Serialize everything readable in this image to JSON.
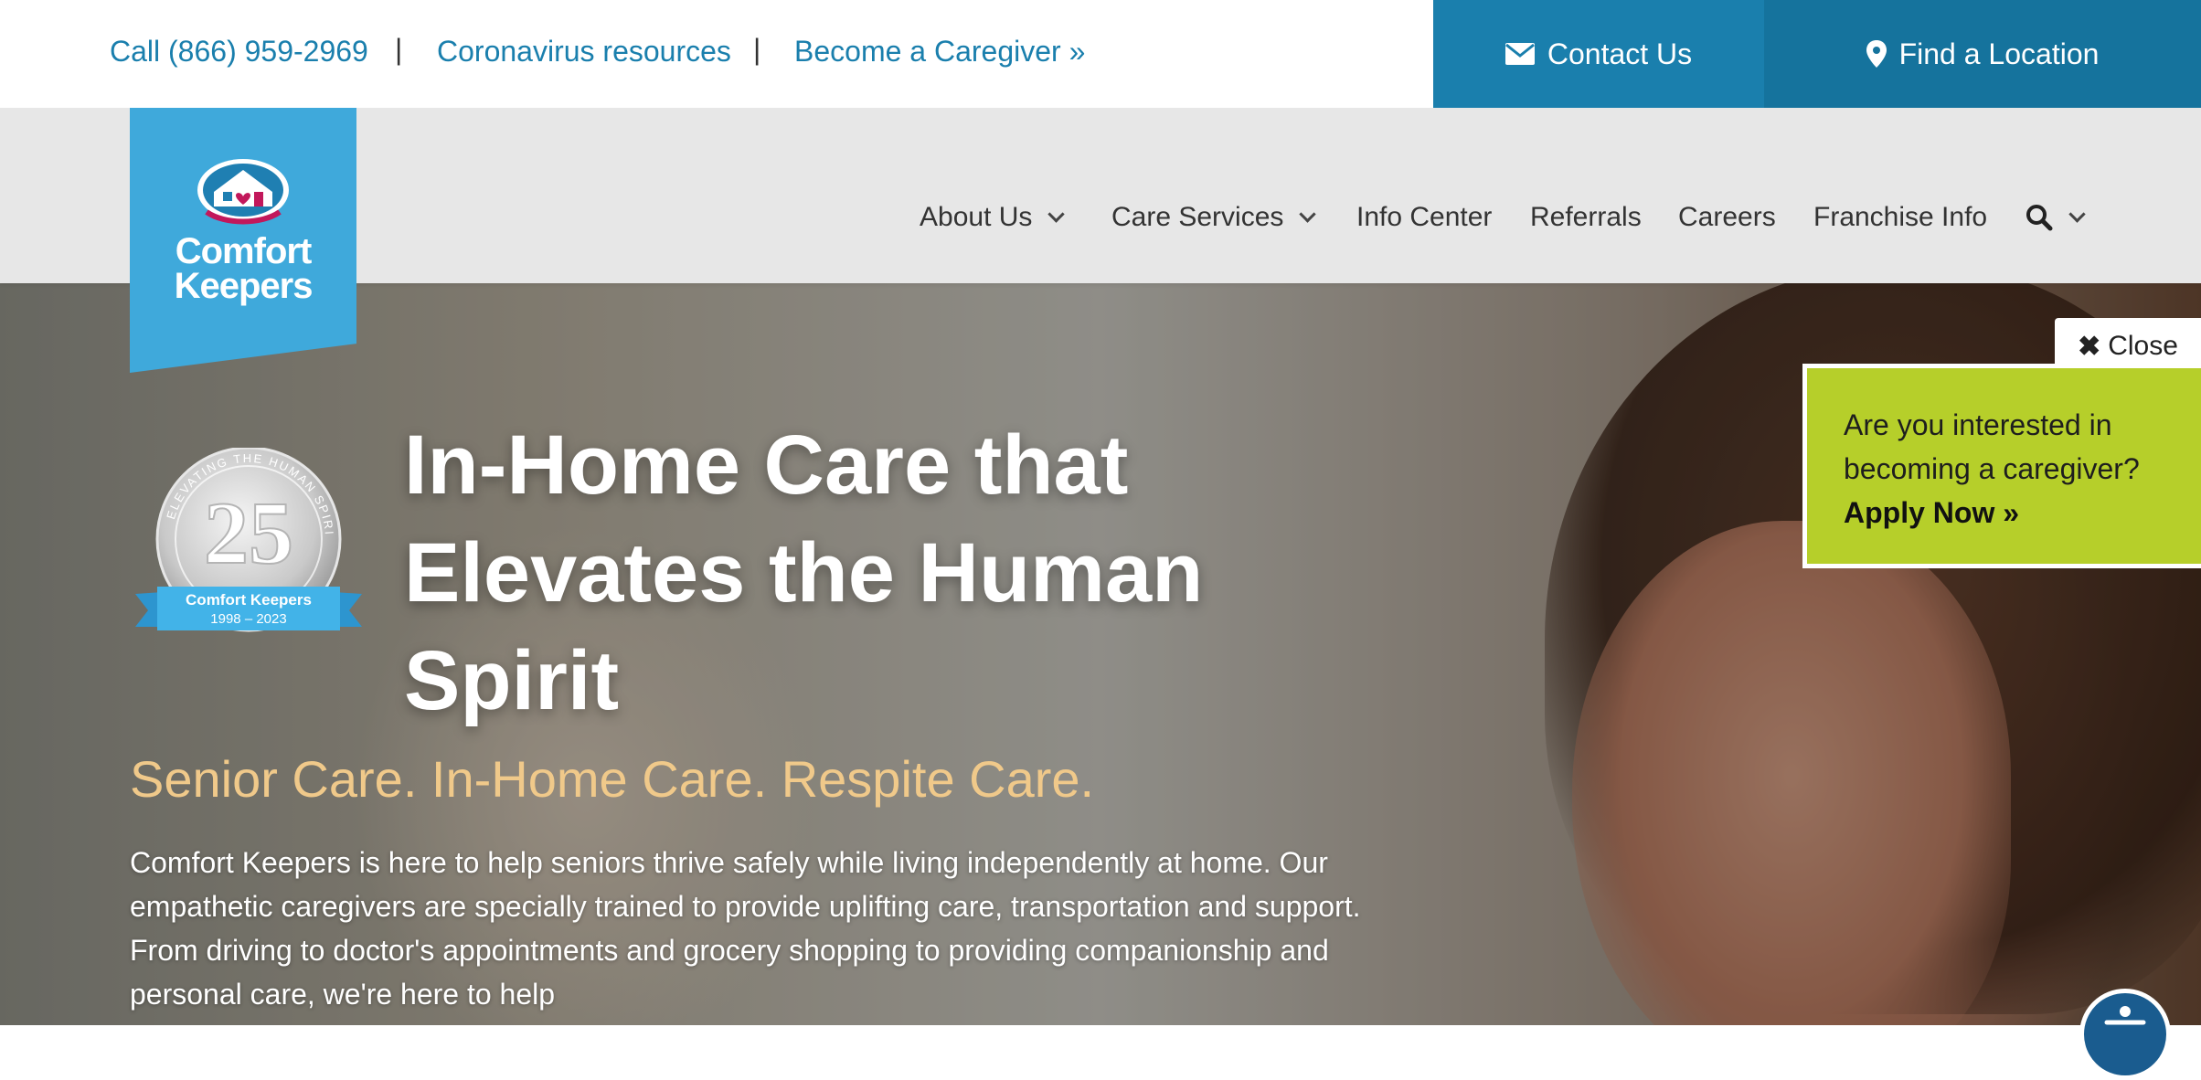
{
  "topbar": {
    "phone": "Call (866) 959-2969",
    "separator": "|",
    "covid": "Coronavirus resources",
    "caregiver": "Become a Caregiver »",
    "contact": "Contact Us",
    "find": "Find a Location"
  },
  "brand": {
    "line1": "Comfort",
    "line2": "Keepers",
    "accent": "#3fa9db"
  },
  "nav": {
    "items": [
      "About Us",
      "Care Services",
      "Info Center",
      "Referrals",
      "Careers",
      "Franchise Info"
    ]
  },
  "badge": {
    "number": "25",
    "arc": "ELEVATING THE HUMAN SPIRIT",
    "name": "Comfort Keepers",
    "years": "1998 – 2023"
  },
  "hero": {
    "title": "In-Home Care that Elevates the Human Spirit",
    "subtitle": "Senior Care. In-Home Care. Respite Care.",
    "body": "Comfort Keepers is here to help seniors thrive safely while living independently at home. Our empathetic caregivers are specially trained to provide uplifting care, transportation and support. From driving to doctor's appointments and grocery shopping to providing companionship and personal care, we're here to help"
  },
  "popup": {
    "close": "Close",
    "question": "Are you interested in becoming a caregiver?",
    "apply": "Apply Now »"
  },
  "colors": {
    "primary": "#1a7fad",
    "popup": "#b6cf2a",
    "subtitle": "#f0c98a"
  }
}
